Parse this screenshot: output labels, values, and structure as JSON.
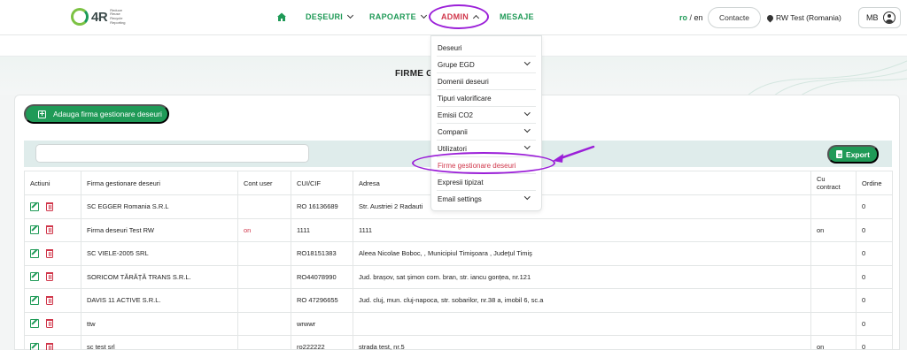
{
  "brand": {
    "name": "4R",
    "tagline": [
      "Reduce",
      "Reuse",
      "Recycle",
      "Reporting"
    ]
  },
  "nav": {
    "home": "home-icon",
    "items": [
      {
        "label": "DEȘEURI"
      },
      {
        "label": "RAPOARTE"
      },
      {
        "label": "ADMIN"
      },
      {
        "label": "MESAJE"
      }
    ]
  },
  "header": {
    "lang_ro": "ro",
    "lang_sep": "/",
    "lang_en": "en",
    "contact_label": "Contacte",
    "location": "RW Test (Romania)",
    "user_initials": "MB"
  },
  "admin_menu": [
    {
      "label": "Deseuri",
      "submenu": false
    },
    {
      "label": "Grupe EGD",
      "submenu": true
    },
    {
      "label": "Domenii deseuri",
      "submenu": false
    },
    {
      "label": "Tipuri valorificare",
      "submenu": false
    },
    {
      "label": "Emisii CO2",
      "submenu": true
    },
    {
      "label": "Companii",
      "submenu": true
    },
    {
      "label": "Utilizatori",
      "submenu": true
    },
    {
      "label": "Firme gestionare deseuri",
      "submenu": false,
      "active": true
    },
    {
      "label": "Expresii tipizat",
      "submenu": false
    },
    {
      "label": "Email settings",
      "submenu": true
    }
  ],
  "page": {
    "title": "FIRME G",
    "add_button": "Adauga firma gestionare deseuri",
    "search_placeholder": "",
    "export_label": "Export"
  },
  "table": {
    "headers": [
      "Actiuni",
      "Firma gestionare deseuri",
      "Cont user",
      "CUI/CIF",
      "Adresa",
      "Cu contract",
      "Ordine"
    ],
    "rows": [
      {
        "firma": "SC EGGER Romania S.R.L",
        "cont": "",
        "cui": "RO 16136689",
        "adresa": "Str. Austriei 2 Radauti",
        "contract": "",
        "ordine": "0"
      },
      {
        "firma": "Firma deseuri Test RW",
        "cont": "on",
        "cui": "1111",
        "adresa": "1111",
        "contract": "on",
        "ordine": "0"
      },
      {
        "firma": "SC VIELE-2005 SRL",
        "cont": "",
        "cui": "RO18151383",
        "adresa": "Aleea Nicolae Boboc, , Municipiul Timişoara , Judeţul Timiş",
        "contract": "",
        "ordine": "0"
      },
      {
        "firma": "SORICOM TĂRĂȚĂ TRANS S.R.L.",
        "cont": "",
        "cui": "RO44078990",
        "adresa": "Jud. brașov, sat șimon com. bran, str. iancu gonțea, nr.121",
        "contract": "",
        "ordine": "0"
      },
      {
        "firma": "DAVIS 11 ACTIVE S.R.L.",
        "cont": "",
        "cui": "RO 47296655",
        "adresa": "Jud. cluj, mun. cluj-napoca, str. sobarilor, nr.38 a, imobil 6, sc.a",
        "contract": "",
        "ordine": "0"
      },
      {
        "firma": "ttw",
        "cont": "",
        "cui": "wrwwr",
        "adresa": "",
        "contract": "",
        "ordine": "0"
      },
      {
        "firma": "sc test srl",
        "cont": "",
        "cui": "ro222222",
        "adresa": "strada test, nr.5",
        "contract": "on",
        "ordine": "0"
      }
    ]
  },
  "colors": {
    "brand_green": "#1f9a57",
    "accent_red": "#d0364a",
    "annotation_purple": "#9b1fd8",
    "filter_bar": "#dfeceb"
  }
}
